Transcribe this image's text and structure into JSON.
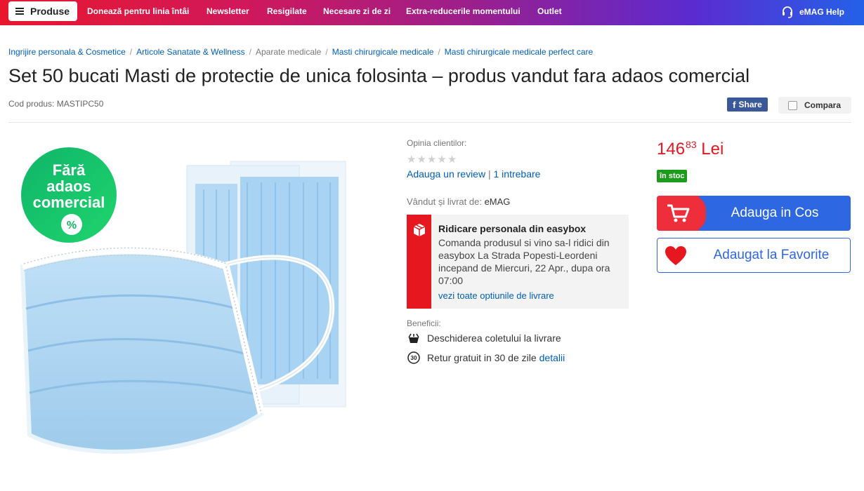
{
  "nav": {
    "menu_label": "Produse",
    "links": [
      "Donează pentru linia întâi",
      "Newsletter",
      "Resigilate",
      "Necesare zi de zi",
      "Extra-reducerile momentului",
      "Outlet"
    ],
    "help_label": "eMAG Help"
  },
  "breadcrumb": {
    "items": [
      "Ingrijire personala & Cosmetice",
      "Articole Sanatate & Wellness",
      "Aparate medicale",
      "Masti chirurgicale medicale",
      "Masti chirurgicale medicale perfect care"
    ]
  },
  "product": {
    "title": "Set 50 bucati Masti de protectie de unica folosinta – produs vandut fara adaos comercial",
    "code": "Cod produs: MASTIPC50",
    "share_label": "Share",
    "compare_label": "Compara",
    "badge_line1": "Fără",
    "badge_line2": "adaos",
    "badge_line3": "comercial",
    "badge_symbol": "%"
  },
  "reviews": {
    "label": "Opinia clientilor:",
    "rating": 0,
    "stars_max": 5,
    "add_review": "Adauga un review",
    "divider": "|",
    "questions": "1 intrebare"
  },
  "seller": {
    "label": "Vândut și livrat de:",
    "name": "eMAG"
  },
  "easybox": {
    "title": "Ridicare personala din easybox",
    "description": "Comanda produsul si vino sa-l ridici din easybox La Strada Popesti-Leordeni incepand de Miercuri, 22 Apr., dupa ora 07:00",
    "link": "vezi toate optiunile de livrare"
  },
  "benefits": {
    "label": "Beneficii:",
    "item1": "Deschiderea coletului la livrare",
    "item2": "Retur gratuit in 30 de zile",
    "item2_link": "detalii",
    "return_days_icon": "30"
  },
  "buy": {
    "price_main": "146",
    "price_decimals": "83",
    "currency": "Lei",
    "stock": "în stoc",
    "add_to_cart": "Adauga in Cos",
    "favorite": "Adaugat la Favorite"
  },
  "colors": {
    "accent_red": "#e6171f",
    "accent_blue": "#2d67e2",
    "link_blue": "#005eb8",
    "stock_green": "#1c9a1c"
  }
}
